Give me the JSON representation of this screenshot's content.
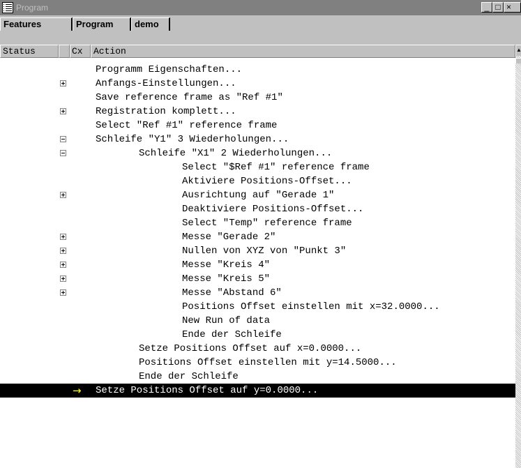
{
  "window": {
    "title": "Program",
    "minimize_label": "_",
    "maximize_label": "□",
    "close_label": "×"
  },
  "tabs": [
    {
      "label": "Features"
    },
    {
      "label": "Program"
    },
    {
      "label": "demo"
    }
  ],
  "columns": {
    "status": "Status",
    "cx": "Cx",
    "action": "Action"
  },
  "rows": [
    {
      "text": "Programm Eigenschaften...",
      "indent": 0,
      "expander": "none"
    },
    {
      "text": "Anfangs-Einstellungen...",
      "indent": 0,
      "expander": "plus"
    },
    {
      "text": "Save reference frame as \"Ref #1\"",
      "indent": 0,
      "expander": "none"
    },
    {
      "text": "Registration komplett...",
      "indent": 0,
      "expander": "plus"
    },
    {
      "text": "Select \"Ref #1\" reference frame",
      "indent": 0,
      "expander": "none"
    },
    {
      "text": "Schleife \"Y1\" 3 Wiederholungen...",
      "indent": 0,
      "expander": "minus"
    },
    {
      "text": "Schleife \"X1\" 2 Wiederholungen...",
      "indent": 1,
      "expander": "minus"
    },
    {
      "text": "Select \"$Ref #1\" reference frame",
      "indent": 2,
      "expander": "none"
    },
    {
      "text": "Aktiviere Positions-Offset...",
      "indent": 2,
      "expander": "none"
    },
    {
      "text": "Ausrichtung auf \"Gerade 1\"",
      "indent": 2,
      "expander": "plus"
    },
    {
      "text": "Deaktiviere Positions-Offset...",
      "indent": 2,
      "expander": "none"
    },
    {
      "text": "Select \"Temp\" reference frame",
      "indent": 2,
      "expander": "none"
    },
    {
      "text": "Messe \"Gerade 2\"",
      "indent": 2,
      "expander": "plus"
    },
    {
      "text": "Nullen von XYZ von \"Punkt 3\"",
      "indent": 2,
      "expander": "plus"
    },
    {
      "text": "Messe \"Kreis 4\"",
      "indent": 2,
      "expander": "plus"
    },
    {
      "text": "Messe \"Kreis 5\"",
      "indent": 2,
      "expander": "plus"
    },
    {
      "text": "Messe \"Abstand 6\"",
      "indent": 2,
      "expander": "plus"
    },
    {
      "text": "Positions Offset einstellen mit x=32.0000...",
      "indent": 2,
      "expander": "none"
    },
    {
      "text": "New Run of data",
      "indent": 2,
      "expander": "none"
    },
    {
      "text": "Ende der Schleife",
      "indent": 2,
      "expander": "none"
    },
    {
      "text": "Setze Positions Offset auf x=0.0000...",
      "indent": 1,
      "expander": "none"
    },
    {
      "text": "Positions Offset einstellen mit y=14.5000...",
      "indent": 1,
      "expander": "none"
    },
    {
      "text": "Ende der Schleife",
      "indent": 1,
      "expander": "none"
    },
    {
      "text": "Setze Positions Offset auf y=0.0000...",
      "indent": 0,
      "expander": "none",
      "selected": true,
      "current_step_marker": "→"
    }
  ],
  "colors": {
    "titlebar_inactive": "#808080",
    "selection": "#000000",
    "current_step_arrow": "#ffff00"
  },
  "icons": {
    "app": "program-list-icon",
    "expanded": "minus-box-icon",
    "collapsed": "plus-box-icon",
    "current_step": "yellow-arrow-icon"
  }
}
